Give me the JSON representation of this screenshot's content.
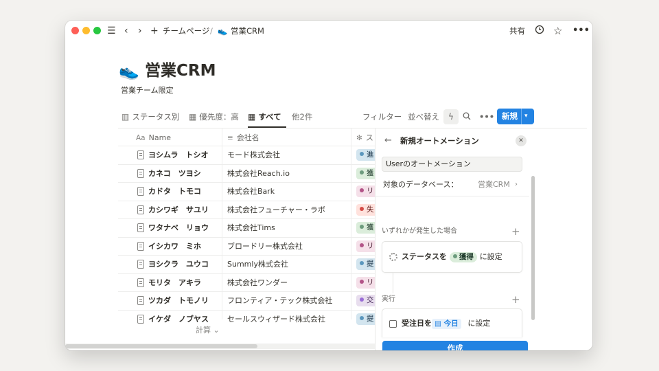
{
  "topbar": {
    "breadcrumb_parent": "チームページ",
    "breadcrumb_sep": "/",
    "breadcrumb_emoji": "👟",
    "breadcrumb_current": "営業CRM",
    "share_label": "共有"
  },
  "page": {
    "emoji": "👟",
    "title": "営業CRM",
    "subtitle": "営業チーム限定"
  },
  "views": {
    "tabs": [
      {
        "label": "ステータス別",
        "icon": "board-icon"
      },
      {
        "label": "優先度：高",
        "icon": "table-icon"
      },
      {
        "label": "すべて",
        "icon": "table-icon",
        "active": true
      },
      {
        "label": "他2件"
      }
    ],
    "actions": {
      "filter": "フィルター",
      "sort": "並べ替え",
      "new_label": "新規"
    }
  },
  "table": {
    "columns": [
      {
        "label": "Name",
        "icon": "Aa"
      },
      {
        "label": "会社名",
        "icon": "text-icon"
      },
      {
        "label": "ス",
        "icon": "status-icon"
      }
    ],
    "rows": [
      {
        "name": "ヨシムラ　トシオ",
        "company": "モード株式会社",
        "status": "進",
        "status_bg": "#d3e5ef",
        "status_dot": "#5b97bd",
        "status_fg": "#183347"
      },
      {
        "name": "カネコ　ツヨシ",
        "company": "株式会社Reach.io",
        "status": "獲",
        "status_bg": "#dbeddb",
        "status_dot": "#6c9b7d",
        "status_fg": "#1c3829"
      },
      {
        "name": "カドタ　トモコ",
        "company": "株式会社Bark",
        "status": "リ",
        "status_bg": "#f5e0e9",
        "status_dot": "#b35488",
        "status_fg": "#4c2337"
      },
      {
        "name": "カシワギ　サユリ",
        "company": "株式会社フューチャー・ラボ",
        "status": "失",
        "status_bg": "#ffe2dd",
        "status_dot": "#d44c47",
        "status_fg": "#5d1715"
      },
      {
        "name": "ワタナベ　リョウ",
        "company": "株式会社Tims",
        "status": "獲",
        "status_bg": "#dbeddb",
        "status_dot": "#6c9b7d",
        "status_fg": "#1c3829"
      },
      {
        "name": "イシカワ　ミホ",
        "company": "ブロードリー株式会社",
        "status": "リ",
        "status_bg": "#f5e0e9",
        "status_dot": "#b35488",
        "status_fg": "#4c2337"
      },
      {
        "name": "ヨシクラ　ユウコ",
        "company": "Summly株式会社",
        "status": "提",
        "status_bg": "#d3e5ef",
        "status_dot": "#5b97bd",
        "status_fg": "#183347"
      },
      {
        "name": "モリタ　アキラ",
        "company": "株式会社ワンダー",
        "status": "リ",
        "status_bg": "#f5e0e9",
        "status_dot": "#b35488",
        "status_fg": "#4c2337"
      },
      {
        "name": "ツカダ　トモノリ",
        "company": "フロンティア・テック株式会社",
        "status": "交",
        "status_bg": "#e8deee",
        "status_dot": "#9a6dd7",
        "status_fg": "#412454"
      },
      {
        "name": "イケダ　ノブヤス",
        "company": "セールスウィザード株式会社",
        "status": "提",
        "status_bg": "#d3e5ef",
        "status_dot": "#5b97bd",
        "status_fg": "#183347"
      }
    ],
    "footer_calc": "計算"
  },
  "panel": {
    "title": "新規オートメーション",
    "name_value": "Userのオートメーション",
    "db_label": "対象のデータベース：",
    "db_value": "営業CRM",
    "trigger_section": "いずれかが発生した場合",
    "trigger": {
      "prefix": "ステータスを",
      "value": "獲得",
      "suffix": "に設定"
    },
    "action_section": "実行",
    "action": {
      "prefix": "受注日を",
      "value": "今日",
      "suffix": "に設定"
    },
    "create_label": "作成"
  },
  "colors": {
    "accent": "#2383e2",
    "traffic_red": "#fe5f57",
    "traffic_yellow": "#febc2e",
    "traffic_green": "#28c840"
  }
}
